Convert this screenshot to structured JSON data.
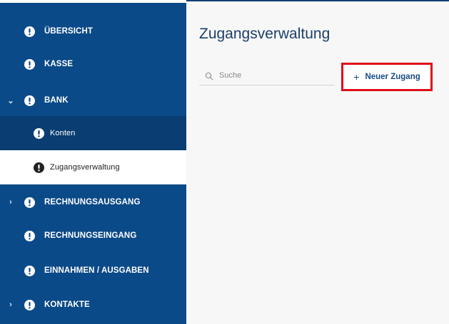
{
  "sidebar": {
    "items": [
      {
        "label": "ÜBERSICHT",
        "expand": ""
      },
      {
        "label": "KASSE",
        "expand": ""
      },
      {
        "label": "BANK",
        "expand": "⌄"
      },
      {
        "label": "Konten",
        "expand": ""
      },
      {
        "label": "Zugangsverwaltung",
        "expand": ""
      },
      {
        "label": "RECHNUNGSAUSGANG",
        "expand": "›"
      },
      {
        "label": "RECHNUNGSEINGANG",
        "expand": ""
      },
      {
        "label": "EINNAHMEN / AUSGABEN",
        "expand": ""
      },
      {
        "label": "KONTAKTE",
        "expand": "›"
      }
    ]
  },
  "main": {
    "title": "Zugangsverwaltung",
    "search": {
      "placeholder": "Suche",
      "value": ""
    },
    "new_button": {
      "icon": "+",
      "label": "Neuer Zugang"
    }
  },
  "colors": {
    "sidebar_bg": "#0b4a88",
    "sidebar_sub_bg": "#0a3d72",
    "highlight_border": "#e10d17",
    "title_color": "#1c3f68",
    "button_text": "#194c86"
  },
  "icons": {
    "nav": "alert-icon",
    "search": "search-icon",
    "add": "plus-icon"
  }
}
